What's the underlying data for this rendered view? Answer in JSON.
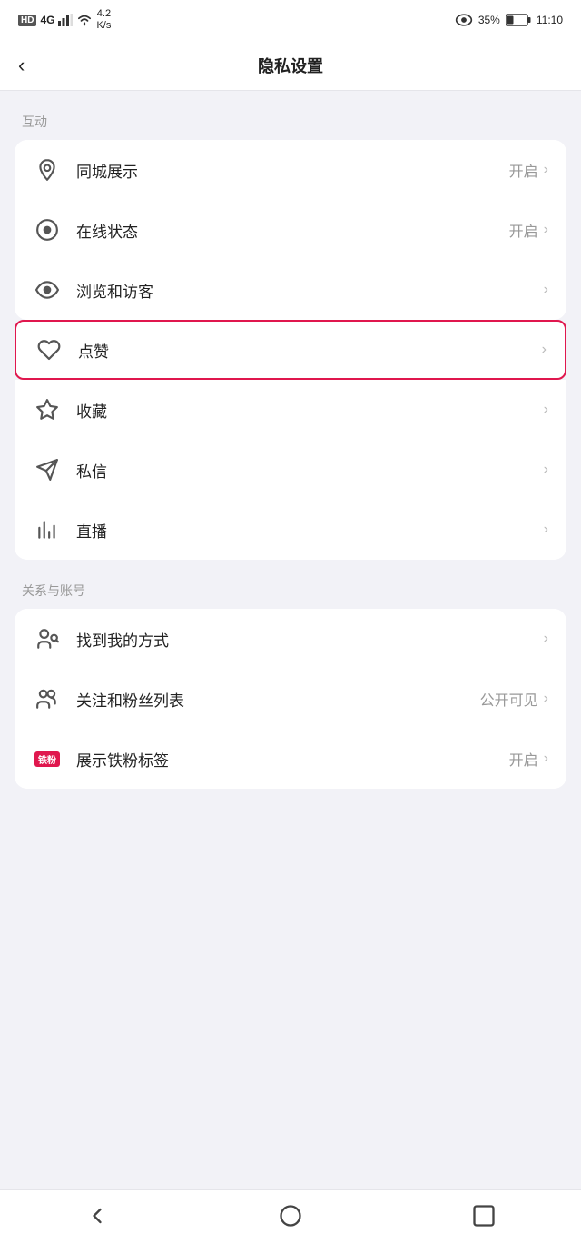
{
  "statusBar": {
    "left": {
      "hd": "HD",
      "signal4g": "4G",
      "wifi": "4.2\nK/s"
    },
    "right": {
      "battery": "35%",
      "time": "11:10"
    }
  },
  "header": {
    "backLabel": "‹",
    "title": "隐私设置"
  },
  "sections": [
    {
      "id": "hudong",
      "title": "互动",
      "items": [
        {
          "id": "tongcheng",
          "icon": "location",
          "label": "同城展示",
          "value": "开启",
          "chevron": "›",
          "highlighted": false
        },
        {
          "id": "zaixian",
          "icon": "online",
          "label": "在线状态",
          "value": "开启",
          "chevron": "›",
          "highlighted": false
        },
        {
          "id": "liulan",
          "icon": "eye",
          "label": "浏览和访客",
          "value": "",
          "chevron": "›",
          "highlighted": false
        },
        {
          "id": "dianzan",
          "icon": "heart",
          "label": "点赞",
          "value": "",
          "chevron": "›",
          "highlighted": true
        },
        {
          "id": "shoucang",
          "icon": "star",
          "label": "收藏",
          "value": "",
          "chevron": "›",
          "highlighted": false
        },
        {
          "id": "sixin",
          "icon": "message",
          "label": "私信",
          "value": "",
          "chevron": "›",
          "highlighted": false
        },
        {
          "id": "zhibo",
          "icon": "bar",
          "label": "直播",
          "value": "",
          "chevron": "›",
          "highlighted": false
        }
      ]
    },
    {
      "id": "guanxi",
      "title": "关系与账号",
      "items": [
        {
          "id": "zhaodao",
          "icon": "person-search",
          "label": "找到我的方式",
          "value": "",
          "chevron": "›",
          "highlighted": false
        },
        {
          "id": "guanzhu",
          "icon": "persons",
          "label": "关注和粉丝列表",
          "value": "公开可见",
          "chevron": "›",
          "highlighted": false
        },
        {
          "id": "tiefen",
          "icon": "tiefen",
          "label": "展示铁粉标签",
          "value": "开启",
          "chevron": "›",
          "highlighted": false
        }
      ]
    }
  ],
  "bottomNav": {
    "back": "◁",
    "home": "○",
    "recent": "□"
  }
}
